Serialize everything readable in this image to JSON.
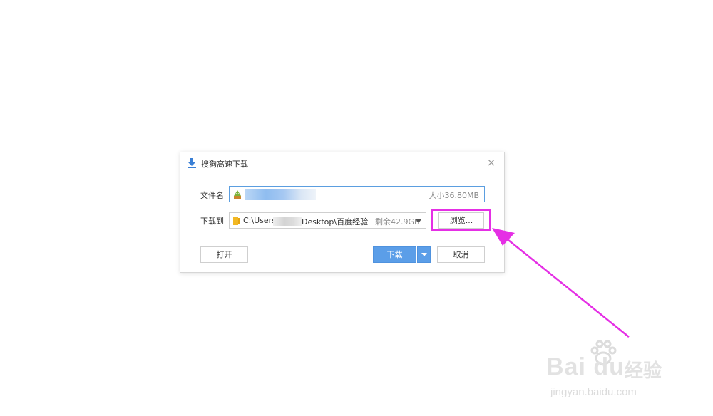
{
  "dialog": {
    "title": "搜狗高速下载",
    "close_glyph": "×",
    "filename_label": "文件名",
    "filename_value": "",
    "filesize": "大小36.80MB",
    "saveto_label": "下载到",
    "path_prefix": "C:\\Users\\",
    "path_suffix": "Desktop\\百度经验",
    "free_space": "剩余42.9GB",
    "browse_label": "浏览...",
    "open_label": "打开",
    "download_label": "下载",
    "cancel_label": "取消"
  },
  "watermark": {
    "logo_latin": "Bai du",
    "logo_cn": "经验",
    "url": "jingyan.baidu.com"
  },
  "colors": {
    "accent": "#5b9ee8",
    "highlight": "#e52fe5",
    "field_focus": "#5b9ee0"
  },
  "icons": {
    "title": "download-icon",
    "filetype": "android-apk-icon",
    "folder": "folder-icon"
  }
}
